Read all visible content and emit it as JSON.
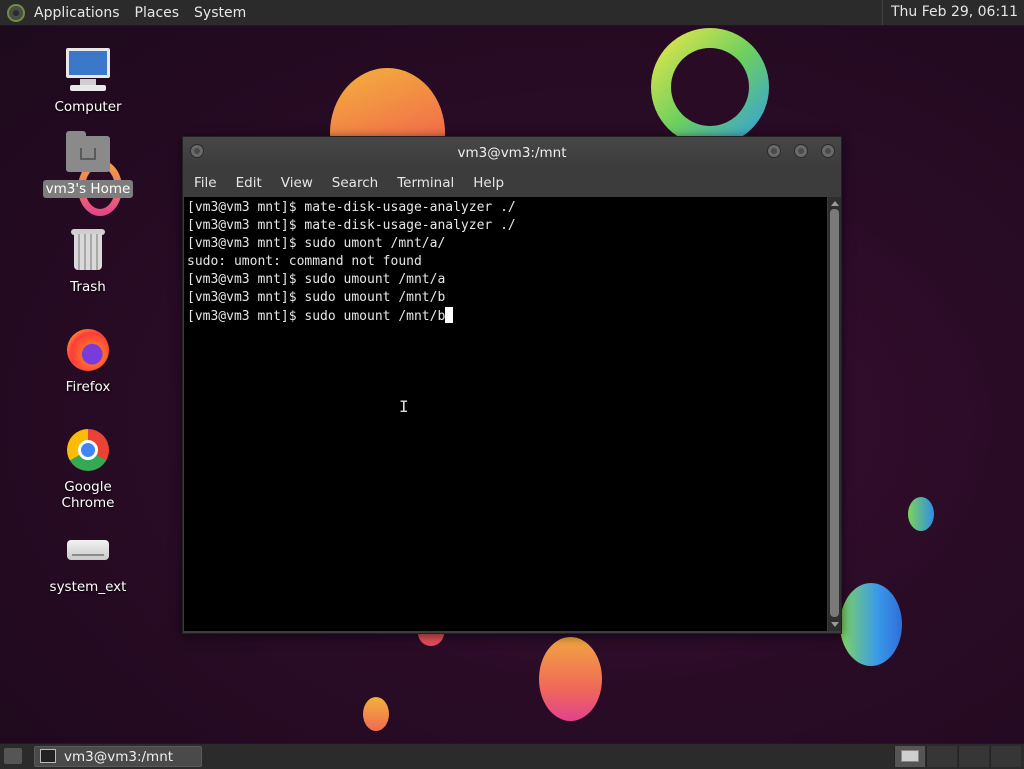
{
  "top_panel": {
    "menus": [
      "Applications",
      "Places",
      "System"
    ],
    "clock": "Thu Feb 29, 06:11"
  },
  "desktop": {
    "icons": [
      {
        "label": "Computer",
        "icon": "computer-icon"
      },
      {
        "label": "vm3's Home",
        "icon": "home-folder-icon",
        "selected": true
      },
      {
        "label": "Trash",
        "icon": "trash-icon"
      },
      {
        "label": "Firefox",
        "icon": "firefox-icon"
      },
      {
        "label": "Google Chrome",
        "icon": "chrome-icon"
      },
      {
        "label": "system_ext",
        "icon": "drive-icon"
      }
    ]
  },
  "terminal": {
    "title": "vm3@vm3:/mnt",
    "menu": [
      "File",
      "Edit",
      "View",
      "Search",
      "Terminal",
      "Help"
    ],
    "lines": [
      "[vm3@vm3 mnt]$ mate-disk-usage-analyzer ./",
      "[vm3@vm3 mnt]$ mate-disk-usage-analyzer ./",
      "[vm3@vm3 mnt]$ sudo umont /mnt/a/",
      "sudo: umont: command not found",
      "[vm3@vm3 mnt]$ sudo umount /mnt/a",
      "[vm3@vm3 mnt]$ sudo umount /mnt/b",
      "[vm3@vm3 mnt]$ sudo umount /mnt/b"
    ]
  },
  "taskbar": {
    "tasks": [
      "vm3@vm3:/mnt"
    ]
  }
}
